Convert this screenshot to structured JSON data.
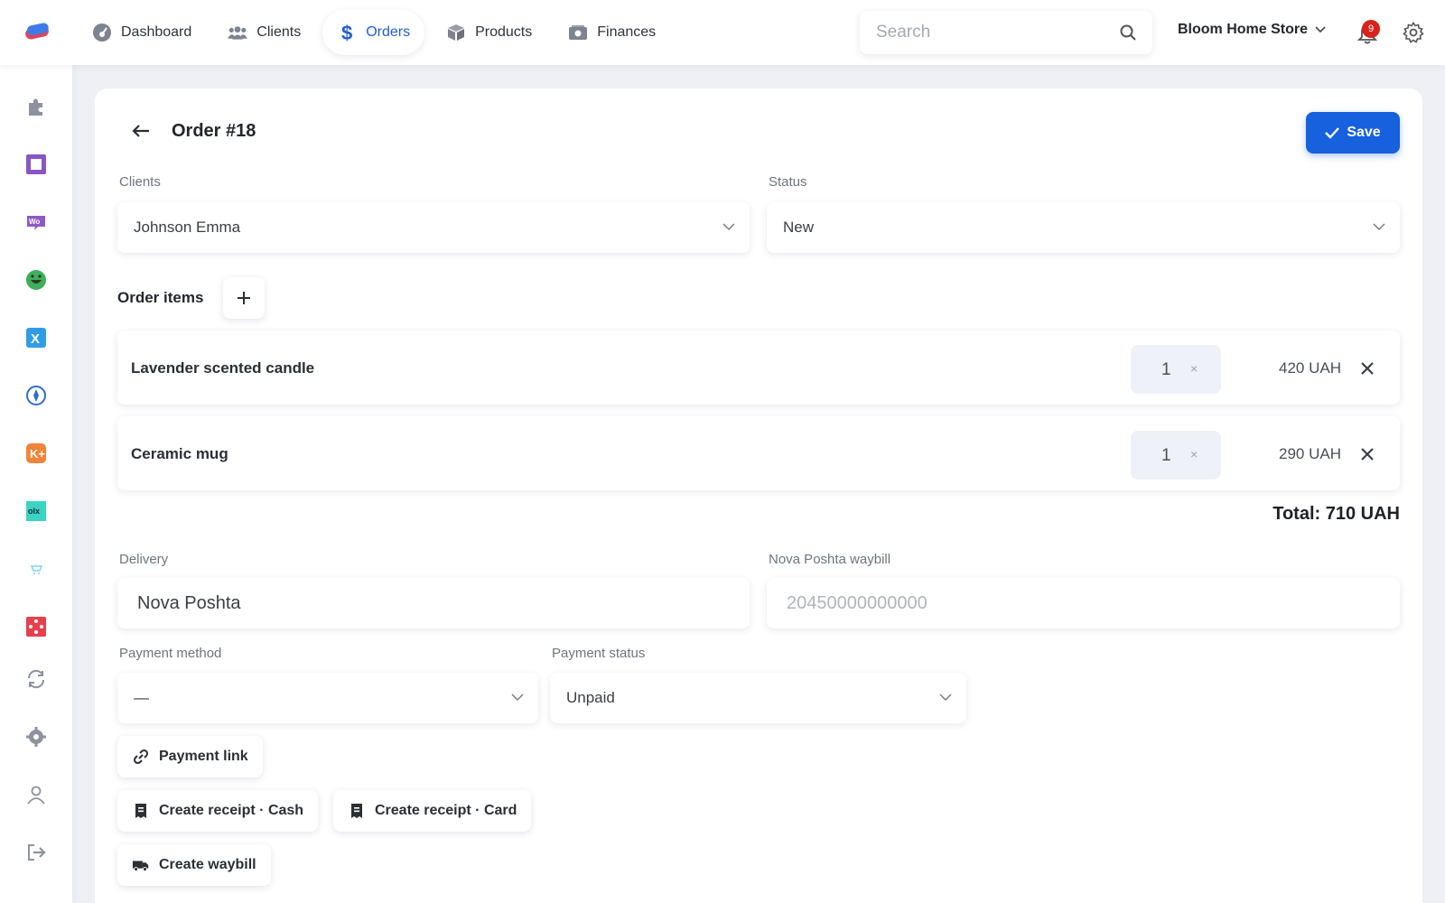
{
  "topbar": {
    "nav": [
      {
        "label": "Dashboard",
        "icon": "dashboard-gauge-icon"
      },
      {
        "label": "Clients",
        "icon": "users-icon"
      },
      {
        "label": "Orders",
        "icon": "dollar-icon",
        "active": true
      },
      {
        "label": "Products",
        "icon": "box-icon"
      },
      {
        "label": "Finances",
        "icon": "money-icon"
      }
    ],
    "search_placeholder": "Search",
    "store_name": "Bloom Home Store",
    "notification_count": "9"
  },
  "sidebar": {
    "icons": [
      "puzzle-icon",
      "square-app-icon",
      "woo-icon",
      "green-face-icon",
      "x-app-icon",
      "pin-app-icon",
      "k-app-icon",
      "olx-icon",
      "cart-icon",
      "dots-app-icon",
      "sync-icon",
      "settings-icon",
      "user-icon",
      "logout-icon"
    ]
  },
  "order": {
    "title": "Order #18",
    "save_label": "Save",
    "clients_label": "Clients",
    "client_value": "Johnson Emma",
    "status_label": "Status",
    "status_value": "New",
    "items_label": "Order items",
    "items": [
      {
        "name": "Lavender scented candle",
        "qty": "1",
        "price": "420 UAH"
      },
      {
        "name": "Ceramic mug",
        "qty": "1",
        "price": "290 UAH"
      }
    ],
    "total": "Total: 710 UAH",
    "delivery_label": "Delivery",
    "delivery_value": "Nova Poshta",
    "waybill_label": "Nova Poshta waybill",
    "waybill_placeholder": "20450000000000",
    "payment_method_label": "Payment method",
    "payment_method_value": "—",
    "payment_status_label": "Payment status",
    "payment_status_value": "Unpaid",
    "payment_link_label": "Payment link",
    "receipt_cash_label": "Create receipt · Cash",
    "receipt_card_label": "Create receipt · Card",
    "waybill_button_label": "Create waybill"
  },
  "colors": {
    "accent": "#1760de",
    "badge": "#d8221c",
    "background": "#eef0f6"
  }
}
